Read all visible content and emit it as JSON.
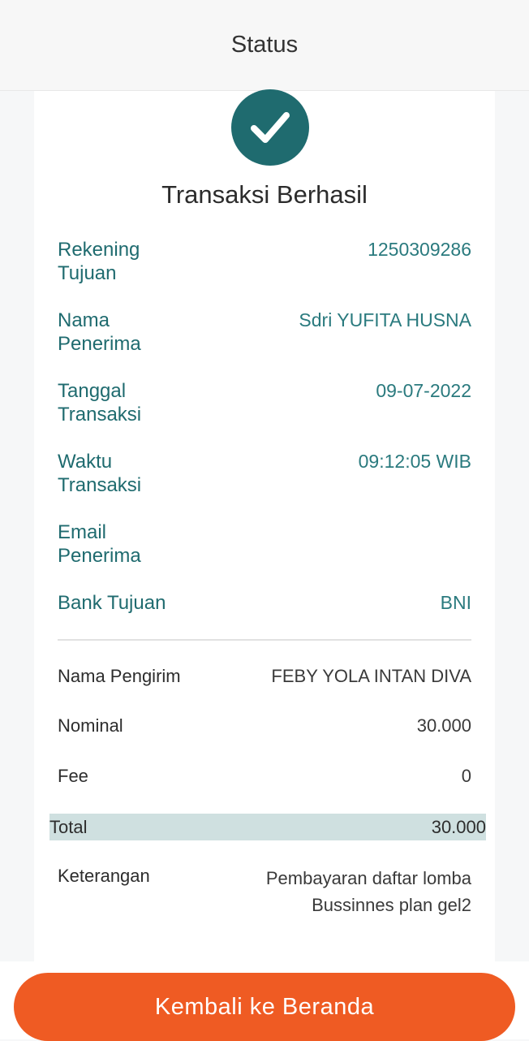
{
  "header": {
    "title": "Status"
  },
  "status": {
    "icon": "check-icon",
    "title": "Transaksi Berhasil"
  },
  "details": {
    "rekening_tujuan": {
      "label": "Rekening Tujuan",
      "value": "1250309286"
    },
    "nama_penerima": {
      "label": "Nama Penerima",
      "value": "Sdri YUFITA HUSNA"
    },
    "tanggal_transaksi": {
      "label": "Tanggal Transaksi",
      "value": "09-07-2022"
    },
    "waktu_transaksi": {
      "label": "Waktu Transaksi",
      "value": "09:12:05 WIB"
    },
    "email_penerima": {
      "label": "Email Penerima",
      "value": ""
    },
    "bank_tujuan": {
      "label": "Bank Tujuan",
      "value": "BNI"
    }
  },
  "summary": {
    "nama_pengirim": {
      "label": "Nama Pengirim",
      "value": "FEBY YOLA INTAN DIVA"
    },
    "nominal": {
      "label": "Nominal",
      "value": "30.000"
    },
    "fee": {
      "label": "Fee",
      "value": "0"
    },
    "total": {
      "label": "Total",
      "value": "30.000"
    },
    "keterangan": {
      "label": "Keterangan",
      "value": "Pembayaran daftar lomba Bussinnes plan gel2"
    }
  },
  "footer": {
    "button_label": "Kembali ke Beranda"
  },
  "colors": {
    "teal": "#1f6b6f",
    "accent": "#ef5b23",
    "total_band": "#cfe0e0"
  }
}
